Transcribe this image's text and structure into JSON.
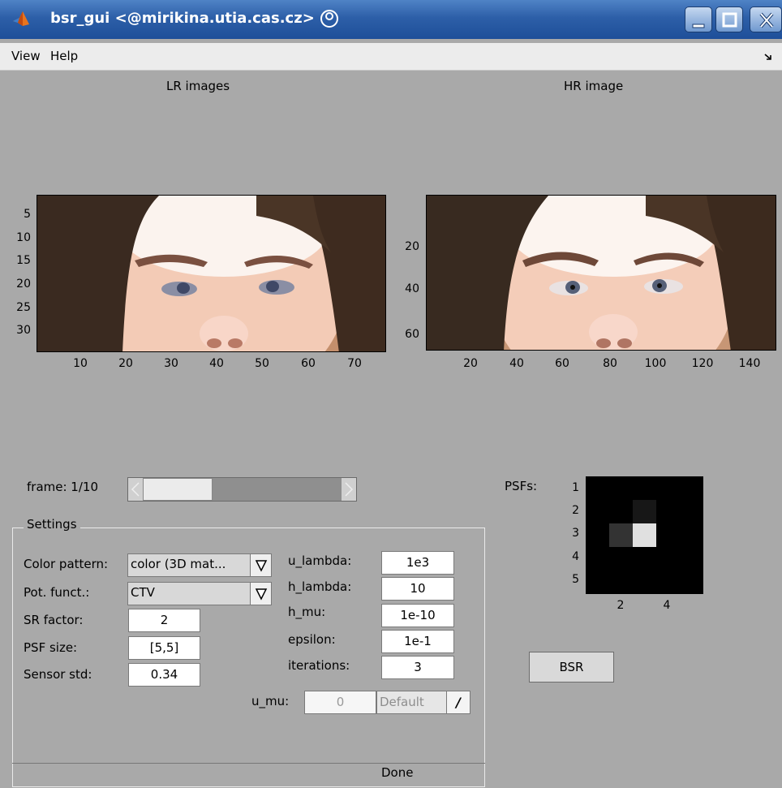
{
  "window": {
    "title": "bsr_gui <@mirikina.utia.cas.cz>",
    "app_icon": "matlab-icon",
    "controls": [
      "minimize-icon",
      "maximize-icon",
      "close-icon"
    ]
  },
  "menubar": {
    "items": [
      "View",
      "Help"
    ],
    "dock_icon": "dock-arrow-icon"
  },
  "lr_plot": {
    "title": "LR images",
    "y_ticks": [
      "5",
      "10",
      "15",
      "20",
      "25",
      "30"
    ],
    "x_ticks": [
      "10",
      "20",
      "30",
      "40",
      "50",
      "60",
      "70"
    ]
  },
  "hr_plot": {
    "title": "HR image",
    "y_ticks": [
      "20",
      "40",
      "60"
    ],
    "x_ticks": [
      "20",
      "40",
      "60",
      "80",
      "100",
      "120",
      "140"
    ]
  },
  "frame": {
    "label": "frame: 1/10",
    "position_fraction": 0.0
  },
  "psf": {
    "label": "PSFs:",
    "y_ticks": [
      "1",
      "2",
      "3",
      "4",
      "5"
    ],
    "x_ticks": [
      "2",
      "4"
    ],
    "grid": [
      [
        0,
        0,
        0,
        0,
        0
      ],
      [
        0,
        0,
        0.09,
        0,
        0
      ],
      [
        0,
        0.2,
        0.88,
        0,
        0
      ],
      [
        0,
        0,
        0,
        0,
        0
      ],
      [
        0,
        0,
        0,
        0,
        0
      ]
    ]
  },
  "settings": {
    "legend": "Settings",
    "color_pattern": {
      "label": "Color pattern:",
      "value": "color (3D mat..."
    },
    "pot_funct": {
      "label": "Pot. funct.:",
      "value": "CTV"
    },
    "sr_factor": {
      "label": "SR factor:",
      "value": "2"
    },
    "psf_size": {
      "label": "PSF size:",
      "value": "[5,5]"
    },
    "sensor_std": {
      "label": "Sensor std:",
      "value": "0.34"
    },
    "u_lambda": {
      "label": "u_lambda:",
      "value": "1e3"
    },
    "h_lambda": {
      "label": "h_lambda:",
      "value": "10"
    },
    "h_mu": {
      "label": "h_mu:",
      "value": "1e-10"
    },
    "epsilon": {
      "label": "epsilon:",
      "value": "1e-1"
    },
    "iterations": {
      "label": "iterations:",
      "value": "3"
    },
    "u_mu": {
      "label": "u_mu:",
      "value": "0",
      "default_label": "Default",
      "toggle_label": "/"
    }
  },
  "bsr_button": "BSR",
  "status": "Done"
}
